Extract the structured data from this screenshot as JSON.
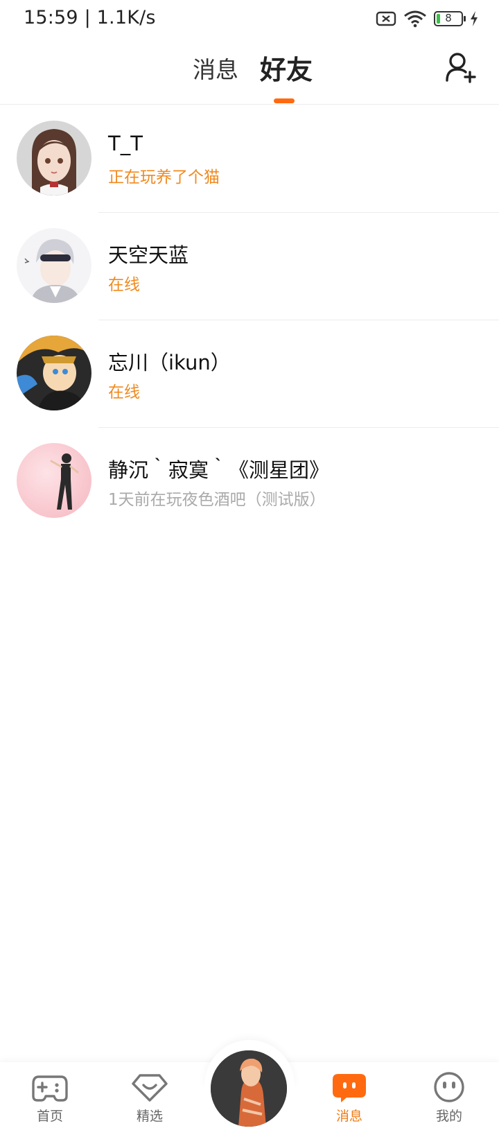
{
  "status_bar": {
    "time": "15:59 | 1.1K/s",
    "battery": "8"
  },
  "header": {
    "tabs": [
      {
        "label": "消息",
        "active": false
      },
      {
        "label": "好友",
        "active": true
      }
    ],
    "add_friend_icon": "add-user-icon",
    "accent_color": "#ff6a10"
  },
  "friends": [
    {
      "name": "T_T",
      "status": "正在玩养了个猫",
      "status_type": "playing"
    },
    {
      "name": "天空天蓝",
      "status": "在线",
      "status_type": "online"
    },
    {
      "name": "忘川（ikun）",
      "status": "在线",
      "status_type": "online"
    },
    {
      "name": "静沉｀寂寞｀《测星团》",
      "status": "1天前在玩夜色酒吧（测试版）",
      "status_type": "offline"
    }
  ],
  "bottom_nav": {
    "items": [
      {
        "label": "首页",
        "icon": "gamepad-icon",
        "active": false
      },
      {
        "label": "精选",
        "icon": "heart-diamond-icon",
        "active": false
      },
      {
        "label": "消息",
        "icon": "chat-bubble-icon",
        "active": true
      },
      {
        "label": "我的",
        "icon": "smiley-face-icon",
        "active": false
      }
    ],
    "active_color": "#f07a12"
  }
}
